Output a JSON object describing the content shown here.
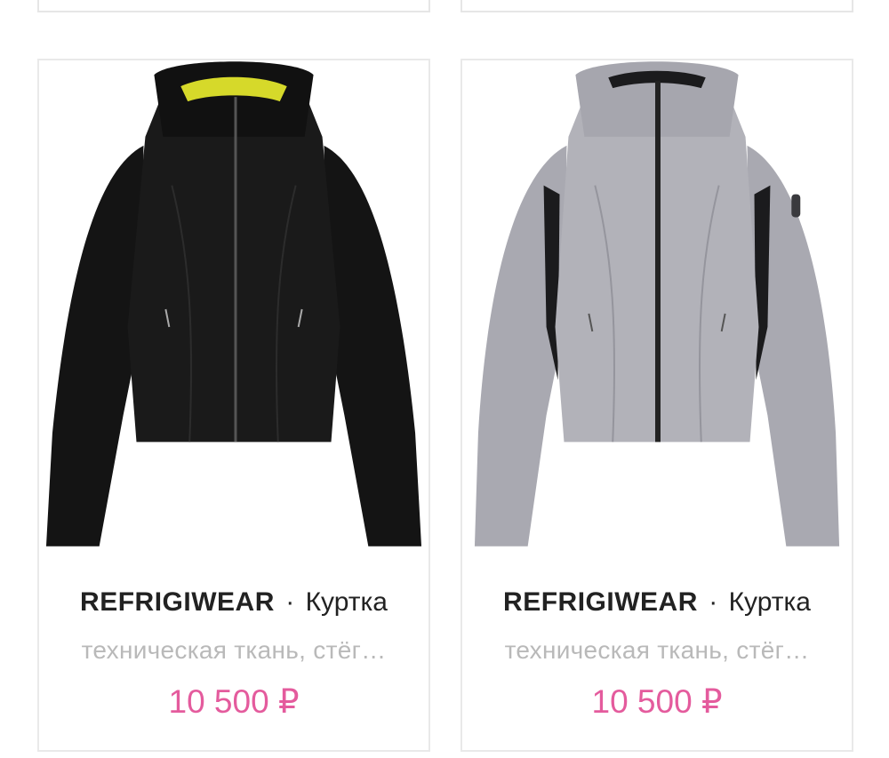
{
  "products": [
    {
      "brand": "REFRIGIWEAR",
      "separator": "·",
      "type": "Куртка",
      "description": "техническая ткань, стёг…",
      "price": "10 500 ₽",
      "jacket_color": "#141414",
      "lining_color": "#d6d92a",
      "image_icon": "black-jacket-image"
    },
    {
      "brand": "REFRIGIWEAR",
      "separator": "·",
      "type": "Куртка",
      "description": "техническая ткань, стёг…",
      "price": "10 500 ₽",
      "jacket_color": "#a9a9b1",
      "lining_color": "#1b1b1d",
      "image_icon": "grey-jacket-image"
    }
  ],
  "colors": {
    "price": "#e45b9d",
    "description": "#b9b9b9",
    "border": "#e9e9e9"
  }
}
